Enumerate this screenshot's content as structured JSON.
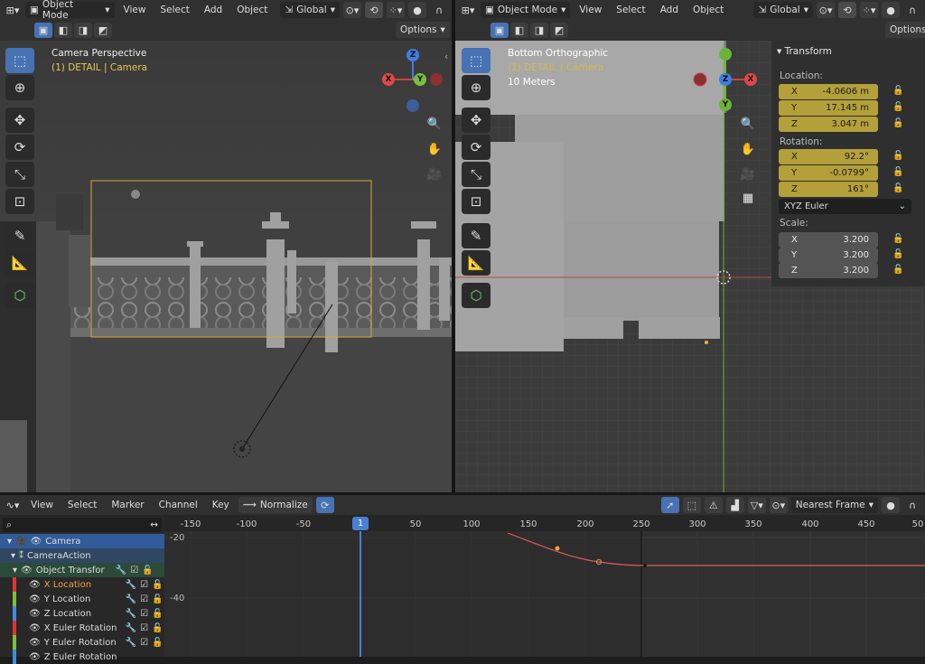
{
  "left_header": {
    "mode": "Object Mode",
    "menus": [
      "View",
      "Select",
      "Add",
      "Object"
    ],
    "orientation": "Global",
    "options": "Options"
  },
  "left_viewport": {
    "title": "Camera Perspective",
    "subtitle": "(1) DETAIL | Camera"
  },
  "right_header": {
    "mode": "Object Mode",
    "menus": [
      "View",
      "Select",
      "Add",
      "Object"
    ],
    "orientation": "Global",
    "options": "Options"
  },
  "right_viewport": {
    "title": "Bottom Orthographic",
    "subtitle": "(1) DETAIL | Camera",
    "scale": "10 Meters"
  },
  "transform": {
    "title": "Transform",
    "location_label": "Location:",
    "location": [
      {
        "axis": "X",
        "value": "-4.0606 m"
      },
      {
        "axis": "Y",
        "value": "17.145 m"
      },
      {
        "axis": "Z",
        "value": "3.047 m"
      }
    ],
    "rotation_label": "Rotation:",
    "rotation": [
      {
        "axis": "X",
        "value": "92.2°"
      },
      {
        "axis": "Y",
        "value": "-0.0799°"
      },
      {
        "axis": "Z",
        "value": "161°"
      }
    ],
    "rotation_mode": "XYZ Euler",
    "scale_label": "Scale:",
    "scale": [
      {
        "axis": "X",
        "value": "3.200"
      },
      {
        "axis": "Y",
        "value": "3.200"
      },
      {
        "axis": "Z",
        "value": "3.200"
      }
    ]
  },
  "gizmo": {
    "x": "X",
    "y": "Y",
    "z": "Z"
  },
  "graph_header": {
    "menus": [
      "View",
      "Select",
      "Marker",
      "Channel",
      "Key"
    ],
    "normalize": "Normalize",
    "snap": "Nearest Frame"
  },
  "timeline": {
    "ticks": [
      "-150",
      "-100",
      "-50",
      "1",
      "50",
      "100",
      "150",
      "200",
      "250",
      "300",
      "350",
      "400",
      "450",
      "50"
    ],
    "current_frame": "1",
    "y_labels": [
      "-20",
      "-40"
    ]
  },
  "channels": [
    {
      "label": "Camera",
      "color": "#4a79c4",
      "level": 0
    },
    {
      "label": "CameraAction",
      "color": "",
      "level": 1
    },
    {
      "label": "Object Transfor",
      "color": "",
      "level": 2
    },
    {
      "label": "X Location",
      "color": "#e03434",
      "level": 3
    },
    {
      "label": "Y Location",
      "color": "#7ac13a",
      "level": 3
    },
    {
      "label": "Z Location",
      "color": "#3f8de0",
      "level": 3
    },
    {
      "label": "X Euler Rotation",
      "color": "#e03434",
      "level": 3
    },
    {
      "label": "Y Euler Rotation",
      "color": "#7ac13a",
      "level": 3
    },
    {
      "label": "Z Euler Rotation",
      "color": "#3f8de0",
      "level": 3
    }
  ]
}
